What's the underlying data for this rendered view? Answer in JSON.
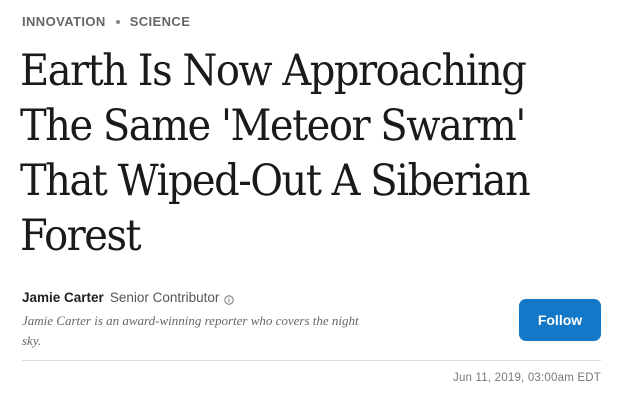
{
  "breadcrumb": {
    "categories": [
      "INNOVATION",
      "SCIENCE"
    ]
  },
  "headline": "Earth Is Now Approaching The Same 'Meteor Swarm' That Wiped-Out A Siberian Forest",
  "author": {
    "name": "Jamie Carter",
    "role": "Senior Contributor",
    "bio": "Jamie Carter is an award-winning reporter who covers the night sky."
  },
  "follow_button": {
    "label": "Follow",
    "color": "#1378c8"
  },
  "published": "Jun 11, 2019, 03:00am EDT",
  "icons": {
    "author_info": "info-icon"
  }
}
